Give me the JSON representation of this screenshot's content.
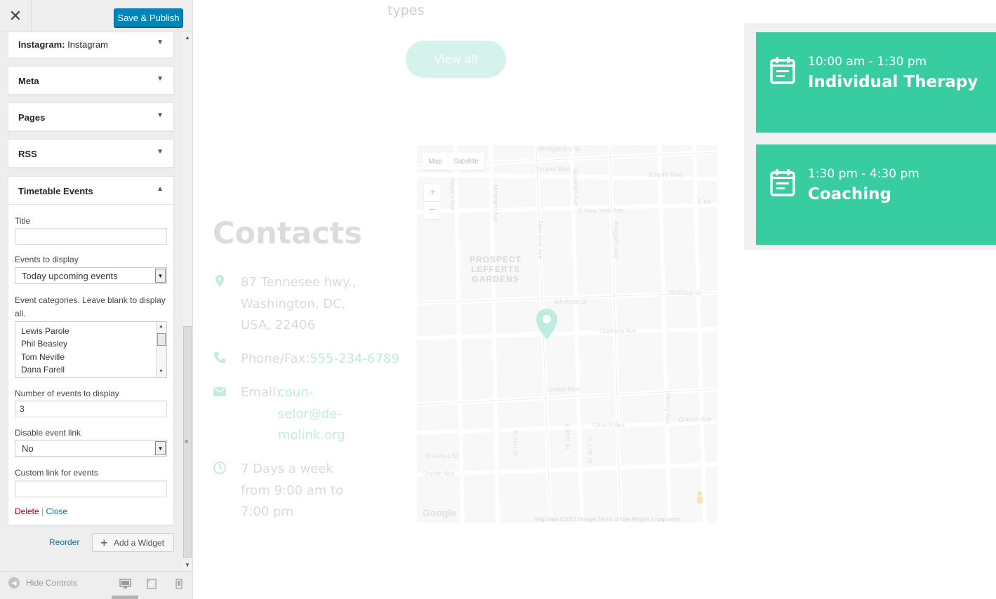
{
  "header": {
    "close_icon": "close-icon",
    "publish_label": "Save & Publish"
  },
  "widgets": [
    {
      "title": "Instagram:",
      "subtitle": " Instagram"
    },
    {
      "title": "Meta"
    },
    {
      "title": "Pages"
    },
    {
      "title": "RSS"
    }
  ],
  "open_widget": {
    "title": "Timetable Events",
    "fields": {
      "title_label": "Title",
      "title_value": "",
      "events_label": "Events to display",
      "events_value": "Today upcoming events",
      "categories_label": "Event categories. Leave blank to display all.",
      "categories": [
        "Lewis Parole",
        "Phil Beasley",
        "Tom Neville",
        "Dana Farell"
      ],
      "number_label": "Number of events to display",
      "number_value": "3",
      "disable_label": "Disable event link",
      "disable_value": "No",
      "custom_label": "Custom link for events",
      "custom_value": ""
    },
    "delete_label": "Delete",
    "separator": "|",
    "close_label": "Close"
  },
  "footer_actions": {
    "reorder_label": "Reorder",
    "add_widget_label": "Add a Widget"
  },
  "footer": {
    "hide_controls_label": "Hide Controls"
  },
  "preview": {
    "types_text": "types",
    "view_all_label": "View all",
    "contacts_title": "Contacts",
    "address_lines": [
      "87 Tennesee hwy.,",
      "Washington, DC,",
      "USA, 22406"
    ],
    "phone_prefix": "Phone/Fax:",
    "phone_value": "555-234-6789",
    "email_prefix": "Email:",
    "email_lines": [
      "coun-",
      "selor@de-",
      "molink.org"
    ],
    "hours_lines": [
      "7 Days a week",
      "from 9:00 am to",
      "7:00 pm"
    ],
    "map": {
      "map_tab": "Map",
      "satellite_tab": "Satellite",
      "zoom_in": "+",
      "zoom_out": "−",
      "district": "PROSPECT LEFFERTS GARDENS",
      "streets": [
        "Montgomery St",
        "Empire Blvd",
        "Empire Blvd",
        "E New York Ave",
        "Winthrop St",
        "Winthrop St",
        "Clarkson Ave",
        "Linden Blvd",
        "Church Ave",
        "Church Ave",
        "Erasmus St",
        "Snyder Ave",
        "Rogers Ave",
        "Nostrand Ave",
        "New York Ave",
        "Brooklyn Ave",
        "Kingston Ave",
        "Albany Ave",
        "E 31st St",
        "E 35th St",
        "E 37th St",
        "E Ne"
      ],
      "google": "Google",
      "attribution": "Map data ©2017 Google    Terms of Use    Report a map error"
    }
  },
  "events": [
    {
      "time": "10:00 am - 1:30 pm",
      "title": "Individual Therapy"
    },
    {
      "time": "1:30 pm - 4:30 pm",
      "title": "Coaching"
    }
  ],
  "colors": {
    "accent": "#38cca1",
    "publish": "#0085ba",
    "link": "#0073aa",
    "delete": "#aa0000"
  }
}
